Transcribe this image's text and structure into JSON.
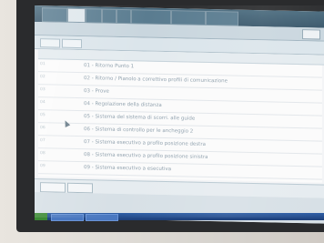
{
  "tabs": [
    "",
    "",
    "",
    "",
    "",
    "",
    "",
    ""
  ],
  "rows": [
    {
      "num": "01",
      "text": "01 - Ritorno Punto 1"
    },
    {
      "num": "02",
      "text": "02 - Ritorno / Pianolo a correttivo profili di comunicazione"
    },
    {
      "num": "03",
      "text": "03 - Prove"
    },
    {
      "num": "04",
      "text": "04 - Regolazione della distanza"
    },
    {
      "num": "05",
      "text": "05 - Sistema del sistema di scorri. alle guide"
    },
    {
      "num": "06",
      "text": "06 - Sistema di controllo per le ancheggio 2"
    },
    {
      "num": "07",
      "text": "07 - Sistema esecutivo a profilo posizione destra"
    },
    {
      "num": "08",
      "text": "08 - Sistema esecutivo a profilo posizione sinistra"
    },
    {
      "num": "09",
      "text": "09 - Sistema esecutivo a esecutiva"
    }
  ],
  "colors": {
    "tabbar": "#4a6b7e",
    "screen": "#f3f4f6",
    "taskbar": "#2f5fa6"
  }
}
